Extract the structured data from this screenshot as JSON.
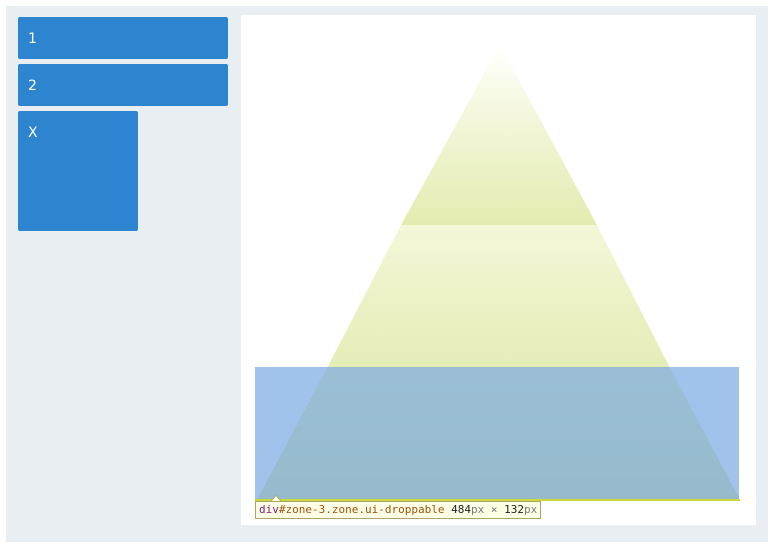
{
  "items": [
    {
      "label": "1"
    },
    {
      "label": "2"
    },
    {
      "label": "X"
    }
  ],
  "inspector_tooltip": {
    "tag": "div",
    "selector": "#zone-3.zone.ui-droppable",
    "width_value": "484",
    "width_unit": "px",
    "times": "×",
    "height_value": "132",
    "height_unit": "px"
  },
  "colors": {
    "item_blue": "#2d85d0",
    "panel_background": "#e8eef1",
    "pyramid_green": "#e3ebaf",
    "highlight_blue": "#6fa2de"
  }
}
